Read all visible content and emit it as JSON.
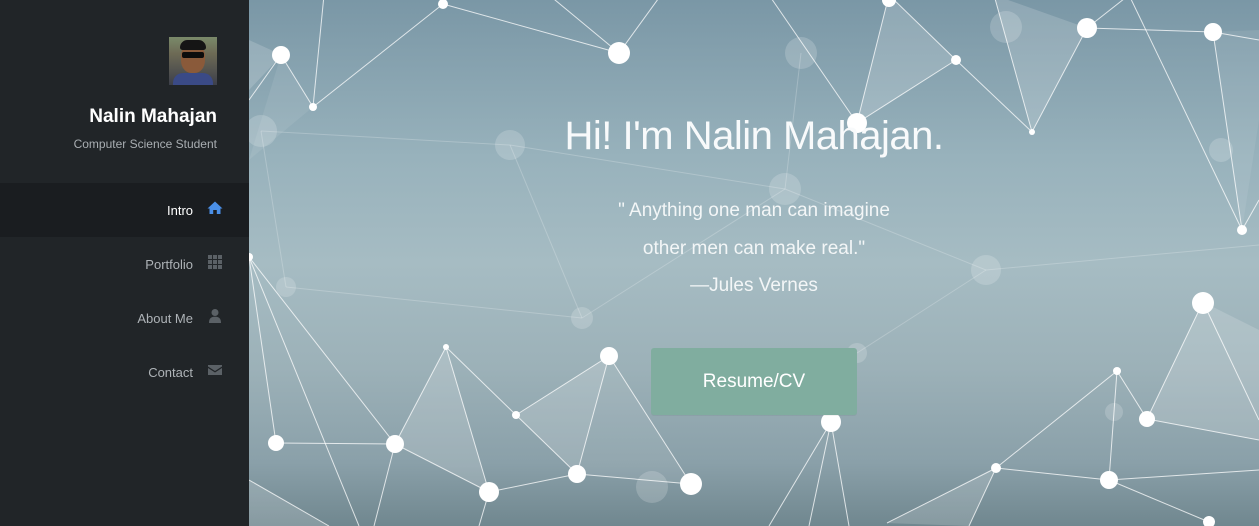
{
  "profile": {
    "name": "Nalin Mahajan",
    "role": "Computer Science Student"
  },
  "nav": {
    "items": [
      {
        "label": "Intro",
        "icon": "home-icon",
        "active": true
      },
      {
        "label": "Portfolio",
        "icon": "grid-icon",
        "active": false
      },
      {
        "label": "About Me",
        "icon": "user-icon",
        "active": false
      },
      {
        "label": "Contact",
        "icon": "envelope-icon",
        "active": false
      }
    ]
  },
  "hero": {
    "greeting": "Hi! I'm",
    "name": "Nalin Mahajan.",
    "quote_line1": "\" Anything one man can imagine",
    "quote_line2": "other men can make real.\"",
    "quote_author": "—Jules Vernes",
    "button_label": "Resume/CV"
  },
  "colors": {
    "sidebar_bg": "#212528",
    "active_item_bg": "#1a1d20",
    "active_icon": "#4a8fe7",
    "button_bg": "#80ad9f"
  }
}
